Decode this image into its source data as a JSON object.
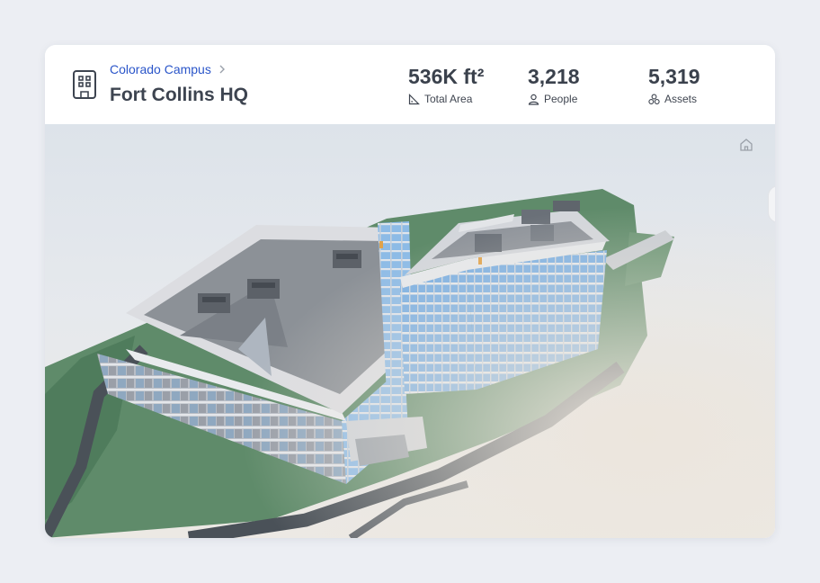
{
  "header": {
    "breadcrumb": {
      "parent": "Colorado Campus"
    },
    "title": "Fort Collins HQ",
    "stats": [
      {
        "value": "536K ft²",
        "label": "Total Area",
        "icon": "area-icon"
      },
      {
        "value": "3,218",
        "label": "People",
        "icon": "person-icon"
      },
      {
        "value": "5,319",
        "label": "Assets",
        "icon": "assets-icon"
      }
    ]
  },
  "colors": {
    "breadcrumb_link": "#2a55c9",
    "title": "#3d4450",
    "background": "#eceef3",
    "terrain": "#5f8b6a",
    "glass": "#7fb4e6"
  },
  "viewer": {
    "home_icon": "home-icon"
  }
}
